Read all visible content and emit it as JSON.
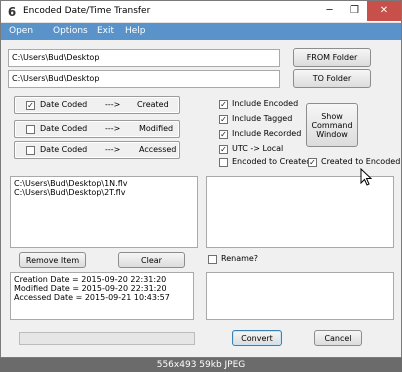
{
  "window": {
    "title": "Encoded Date/Time Transfer",
    "app_icon": "6",
    "min_glyph": "─",
    "max_glyph": "❐",
    "close_glyph": "✕"
  },
  "menu": [
    "Open",
    "Options",
    "Exit",
    "Help"
  ],
  "paths": {
    "from_value": "C:\\Users\\Bud\\Desktop",
    "to_value": "C:\\Users\\Bud\\Desktop",
    "from_button": "FROM Folder",
    "to_button": "TO Folder"
  },
  "date_rows": [
    {
      "label": "Date Coded",
      "arrow": "--->",
      "target": "Created",
      "checked": true
    },
    {
      "label": "Date Coded",
      "arrow": "--->",
      "target": "Modified",
      "checked": false
    },
    {
      "label": "Date Coded",
      "arrow": "--->",
      "target": "Accessed",
      "checked": false
    }
  ],
  "options": {
    "include_encoded": {
      "label": "Include Encoded",
      "checked": true
    },
    "include_tagged": {
      "label": "Include Tagged",
      "checked": true
    },
    "include_recorded": {
      "label": "Include Recorded",
      "checked": true
    },
    "utc_local": {
      "label": "UTC -> Local",
      "checked": true
    },
    "encoded_to_created": {
      "label": "Encoded to Created",
      "checked": false
    },
    "created_to_encoded": {
      "label": "Created to Encoded",
      "checked": true
    }
  },
  "show_command_window_label": "Show\nCommand\nWindow",
  "file_list": [
    "C:\\Users\\Bud\\Desktop\\1N.flv",
    "C:\\Users\\Bud\\Desktop\\2T.flv"
  ],
  "buttons": {
    "remove_item": "Remove Item",
    "clear": "Clear",
    "convert": "Convert",
    "cancel": "Cancel"
  },
  "rename": {
    "label": "Rename?",
    "checked": false
  },
  "date_info": [
    "Creation Date = 2015-09-20 22:31:20",
    "Modified Date = 2015-09-20 22:31:20",
    "Accessed Date = 2015-09-21 10:43:57"
  ],
  "check_glyph": "✓",
  "caption": "556x493  59kb  JPEG"
}
